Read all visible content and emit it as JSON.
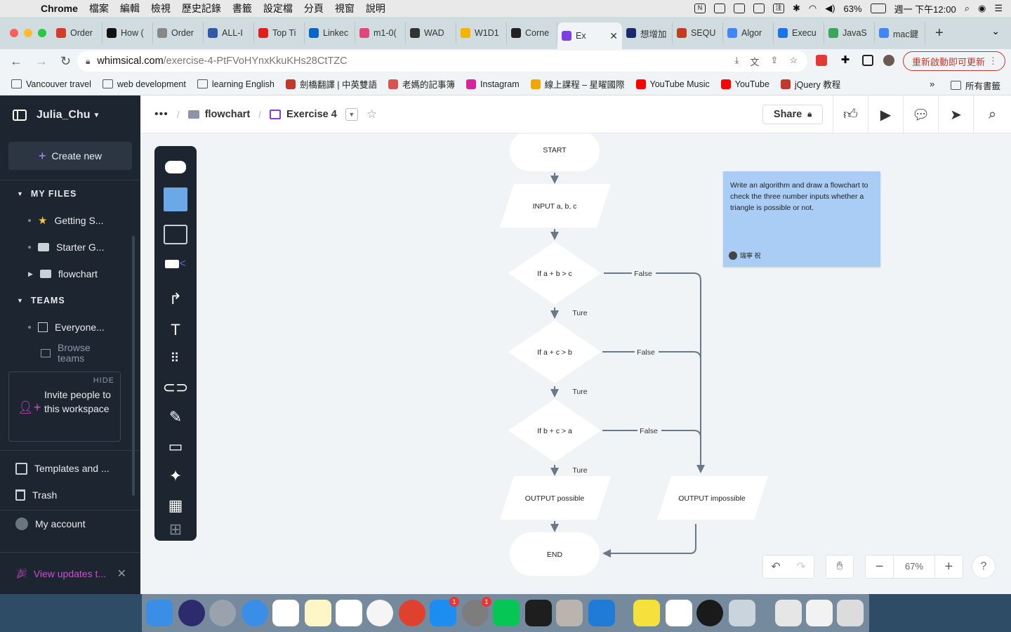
{
  "menubar": {
    "app": "Chrome",
    "items": [
      "檔案",
      "編輯",
      "檢視",
      "歷史記錄",
      "書籤",
      "設定檔",
      "分頁",
      "視窗",
      "說明"
    ],
    "battery": "63%",
    "clock": "週一 下午12:00"
  },
  "tabs": [
    {
      "label": "Order",
      "color": "#d33b2c"
    },
    {
      "label": "How (",
      "color": "#111111"
    },
    {
      "label": "Order",
      "color": "#888888"
    },
    {
      "label": "ALL-I",
      "color": "#2e5aa8"
    },
    {
      "label": "Top Ti",
      "color": "#e02020"
    },
    {
      "label": "Linkec",
      "color": "#0a66c2"
    },
    {
      "label": "m1-0(",
      "color": "#e0457b"
    },
    {
      "label": "WAD",
      "color": "#333333"
    },
    {
      "label": "W1D1",
      "color": "#f4b400"
    },
    {
      "label": "Corne",
      "color": "#222222"
    },
    {
      "label": "Ex",
      "color": "#7b3fe4",
      "active": true
    },
    {
      "label": "想增加",
      "color": "#1b2a6b"
    },
    {
      "label": "SEQU",
      "color": "#c23b22"
    },
    {
      "label": "Algor",
      "color": "#4285f4"
    },
    {
      "label": "Execu",
      "color": "#1a73e8"
    },
    {
      "label": "JavaS",
      "color": "#3ba55c"
    },
    {
      "label": "mac鍵",
      "color": "#4285f4"
    }
  ],
  "omnibox": {
    "host": "whimsical.com",
    "path": "/exercise-4-PtFVoHYnxKkuKHs28CtTZC"
  },
  "update_button": "重新啟動即可更新",
  "bookmarks": [
    {
      "label": "Vancouver travel",
      "type": "folder"
    },
    {
      "label": "web development",
      "type": "folder"
    },
    {
      "label": "learning English",
      "type": "folder"
    },
    {
      "label": "劍橋翻譯 | 中英雙語",
      "type": "site",
      "color": "#c0392b"
    },
    {
      "label": "老媽的記事簿",
      "type": "site",
      "color": "#d9534f"
    },
    {
      "label": "Instagram",
      "type": "site",
      "color": "#d6249f"
    },
    {
      "label": "線上課程 – 星曜國際",
      "type": "site",
      "color": "#f0a500"
    },
    {
      "label": "YouTube Music",
      "type": "site",
      "color": "#ff0000"
    },
    {
      "label": "YouTube",
      "type": "site",
      "color": "#ff0000"
    },
    {
      "label": "jQuery 教程",
      "type": "site",
      "color": "#c0392b"
    }
  ],
  "bookmarks_more": "»",
  "bookmarks_all": "所有書籤",
  "sidebar": {
    "workspace": "Julia_Chu",
    "create_new": "Create new",
    "my_files_header": "MY FILES",
    "files": [
      {
        "label": "Getting S...",
        "icon": "star"
      },
      {
        "label": "Starter G...",
        "icon": "folder"
      },
      {
        "label": "flowchart",
        "icon": "folder"
      }
    ],
    "teams_header": "TEAMS",
    "team": "Everyone...",
    "browse_teams": "Browse teams",
    "invite_hide": "HIDE",
    "invite_text": "Invite people to this workspace",
    "templates": "Templates and ...",
    "trash": "Trash",
    "my_account": "My account",
    "view_updates": "View updates t..."
  },
  "appbar": {
    "folder": "flowchart",
    "document": "Exercise 4",
    "share": "Share"
  },
  "flowchart": {
    "start": "START",
    "input": "INPUT a, b, c",
    "cond1": "If a + b > c",
    "cond2": "If a + c > b",
    "cond3": "If b + c > a",
    "true_label": "Ture",
    "false_label": "False",
    "out_possible": "OUTPUT  possible",
    "out_impossible": "OUTPUT impossible",
    "end": "END"
  },
  "note": {
    "text": "Write an algorithm and draw a flowchart to check the three number inputs whether a triangle is possible or not.",
    "author": "瑞寧 祝"
  },
  "zoom": "67%",
  "help": "?"
}
